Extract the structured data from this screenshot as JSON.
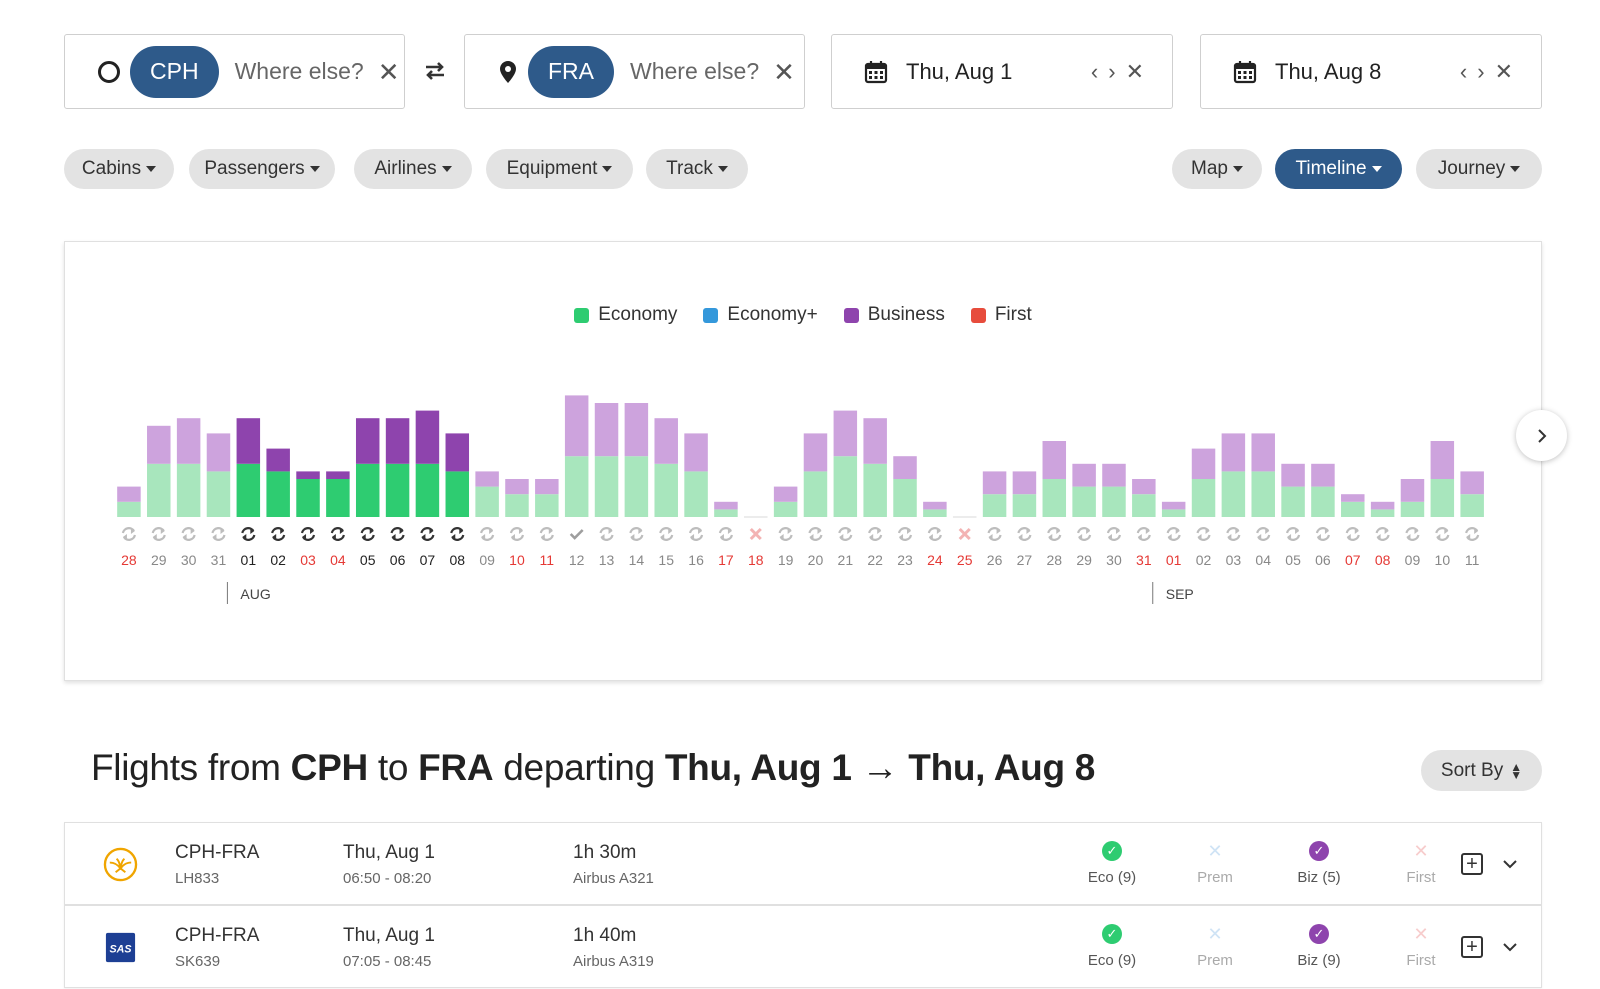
{
  "search": {
    "origin": {
      "airport": "CPH",
      "placeholder": "Where else?"
    },
    "destination": {
      "airport": "FRA",
      "placeholder": "Where else?"
    },
    "depart_date": "Thu, Aug 1",
    "return_date": "Thu, Aug 8"
  },
  "filters": {
    "left": [
      "Cabins",
      "Passengers",
      "Airlines",
      "Equipment",
      "Track"
    ],
    "right": [
      "Map",
      "Timeline",
      "Journey"
    ],
    "active": "Timeline"
  },
  "legend": [
    {
      "label": "Economy",
      "color": "#2ecc71"
    },
    {
      "label": "Economy+",
      "color": "#3498db"
    },
    {
      "label": "Business",
      "color": "#8e44ad"
    },
    {
      "label": "First",
      "color": "#e74c3c"
    }
  ],
  "chart_data": {
    "type": "bar",
    "stacked": true,
    "months": [
      {
        "label": "AUG",
        "start_index": 4
      },
      {
        "label": "SEP",
        "start_index": 35
      }
    ],
    "categories": [
      "28",
      "29",
      "30",
      "31",
      "01",
      "02",
      "03",
      "04",
      "05",
      "06",
      "07",
      "08",
      "09",
      "10",
      "11",
      "12",
      "13",
      "14",
      "15",
      "16",
      "17",
      "18",
      "19",
      "20",
      "21",
      "22",
      "23",
      "24",
      "25",
      "26",
      "27",
      "28",
      "29",
      "30",
      "31",
      "01",
      "02",
      "03",
      "04",
      "05",
      "06",
      "07",
      "08",
      "09",
      "10",
      "11"
    ],
    "weekend": [
      true,
      false,
      false,
      false,
      false,
      false,
      true,
      true,
      false,
      false,
      false,
      false,
      false,
      true,
      true,
      false,
      false,
      false,
      false,
      false,
      true,
      true,
      false,
      false,
      false,
      false,
      false,
      true,
      true,
      false,
      false,
      false,
      false,
      false,
      true,
      true,
      false,
      false,
      false,
      false,
      false,
      true,
      true,
      false,
      false,
      false
    ],
    "selected_range": [
      4,
      11
    ],
    "status": [
      "sync",
      "sync",
      "sync",
      "sync",
      "sync",
      "sync",
      "sync",
      "sync",
      "sync",
      "sync",
      "sync",
      "sync",
      "sync",
      "sync",
      "sync",
      "check",
      "sync",
      "sync",
      "sync",
      "sync",
      "sync",
      "none",
      "sync",
      "sync",
      "sync",
      "sync",
      "sync",
      "sync",
      "none",
      "sync",
      "sync",
      "sync",
      "sync",
      "sync",
      "sync",
      "sync",
      "sync",
      "sync",
      "sync",
      "sync",
      "sync",
      "sync",
      "sync",
      "sync",
      "sync",
      "sync"
    ],
    "series": [
      {
        "name": "Economy",
        "values": [
          2,
          7,
          7,
          6,
          7,
          6,
          5,
          5,
          7,
          7,
          7,
          6,
          4,
          3,
          3,
          8,
          8,
          8,
          7,
          6,
          1,
          0,
          2,
          6,
          8,
          7,
          5,
          1,
          0,
          3,
          3,
          5,
          4,
          4,
          3,
          1,
          5,
          6,
          6,
          4,
          4,
          2,
          1,
          2,
          5,
          3
        ]
      },
      {
        "name": "Business",
        "values": [
          2,
          5,
          6,
          5,
          6,
          3,
          1,
          1,
          6,
          6,
          7,
          5,
          2,
          2,
          2,
          8,
          7,
          7,
          6,
          5,
          1,
          0,
          2,
          5,
          6,
          6,
          3,
          1,
          0,
          3,
          3,
          5,
          3,
          3,
          2,
          1,
          4,
          5,
          5,
          3,
          3,
          1,
          1,
          3,
          5,
          3
        ]
      }
    ]
  },
  "results": {
    "title_prefix": "Flights from",
    "origin": "CPH",
    "to": "to",
    "destination": "FRA",
    "departing": "departing",
    "date_range": "Thu, Aug 1 → Thu, Aug 8",
    "sort_label": "Sort By",
    "flights": [
      {
        "route": "CPH-FRA",
        "flight_no": "LH833",
        "date": "Thu, Aug 1",
        "times": "06:50 - 08:20",
        "duration": "1h 30m",
        "aircraft": "Airbus A321",
        "eco": "Eco (9)",
        "prem": "Prem",
        "biz": "Biz (5)",
        "first": "First"
      },
      {
        "route": "CPH-FRA",
        "flight_no": "SK639",
        "date": "Thu, Aug 1",
        "times": "07:05 - 08:45",
        "duration": "1h 40m",
        "aircraft": "Airbus A319",
        "airline_logo_text": "SAS",
        "eco": "Eco (9)",
        "prem": "Prem",
        "biz": "Biz (9)",
        "first": "First"
      }
    ]
  }
}
